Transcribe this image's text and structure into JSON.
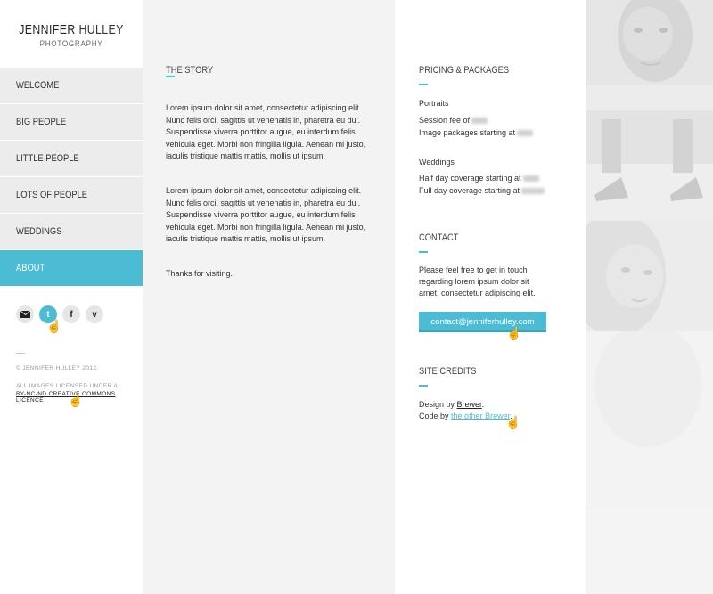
{
  "logo": {
    "name_first": "JENNIFER",
    "name_last": "HULLEY",
    "tagline": "PHOTOGRAPHY"
  },
  "nav": [
    {
      "label": "WELCOME",
      "active": false
    },
    {
      "label": "BIG PEOPLE",
      "active": false
    },
    {
      "label": "LITTLE PEOPLE",
      "active": false
    },
    {
      "label": "LOTS OF PEOPLE",
      "active": false
    },
    {
      "label": "WEDDINGS",
      "active": false
    },
    {
      "label": "ABOUT",
      "active": true
    }
  ],
  "social": [
    "email-icon",
    "twitter-icon",
    "facebook-icon",
    "vimeo-icon"
  ],
  "footer": {
    "copyright": "© JENNIFER HULLEY 2012.",
    "license_prefix": "ALL IMAGES LICENSED UNDER A",
    "license_link": "BY-NC-ND CREATIVE COMMONS LICENCE"
  },
  "story": {
    "heading": "THE STORY",
    "para1": "Lorem ipsum dolor sit amet, consectetur adipiscing elit. Nunc felis orci, sagittis ut venenatis in, pharetra eu dui. Suspendisse viverra porttitor augue, eu interdum felis vehicula eget. Morbi non fringilla ligula. Aenean mi justo, iaculis tristique mattis mattis, mollis ut ipsum.",
    "para2": "Lorem ipsum dolor sit amet, consectetur adipiscing elit. Nunc felis orci, sagittis ut venenatis in, pharetra eu dui. Suspendisse viverra porttitor augue, eu interdum felis vehicula eget. Morbi non fringilla ligula. Aenean mi justo, iaculis tristique mattis mattis, mollis ut ipsum.",
    "para3": "Thanks for visiting."
  },
  "pricing": {
    "heading": "PRICING & PACKAGES",
    "portraits_title": "Portraits",
    "session_fee": "Session fee of",
    "image_packages": "Image packages starting at",
    "weddings_title": "Weddings",
    "half_day": "Half day coverage starting at",
    "full_day": "Full day coverage starting at"
  },
  "contact": {
    "heading": "CONTACT",
    "line1": "Please feel free to get in touch",
    "line2": "regarding lorem ipsum dolor sit",
    "line3": "amet, consectetur adipiscing elit.",
    "email": "contact@jenniferhulley.com"
  },
  "credits": {
    "heading": "SITE CREDITS",
    "design_prefix": "Design by",
    "design_link": "Brewer",
    "design_suffix": ".",
    "code_prefix": "Code by",
    "code_link": "the other Brewer",
    "code_suffix": "."
  },
  "colors": {
    "accent": "#4cbcd4",
    "nav_bg": "#ececec",
    "story_bg": "#f3f3f3"
  }
}
